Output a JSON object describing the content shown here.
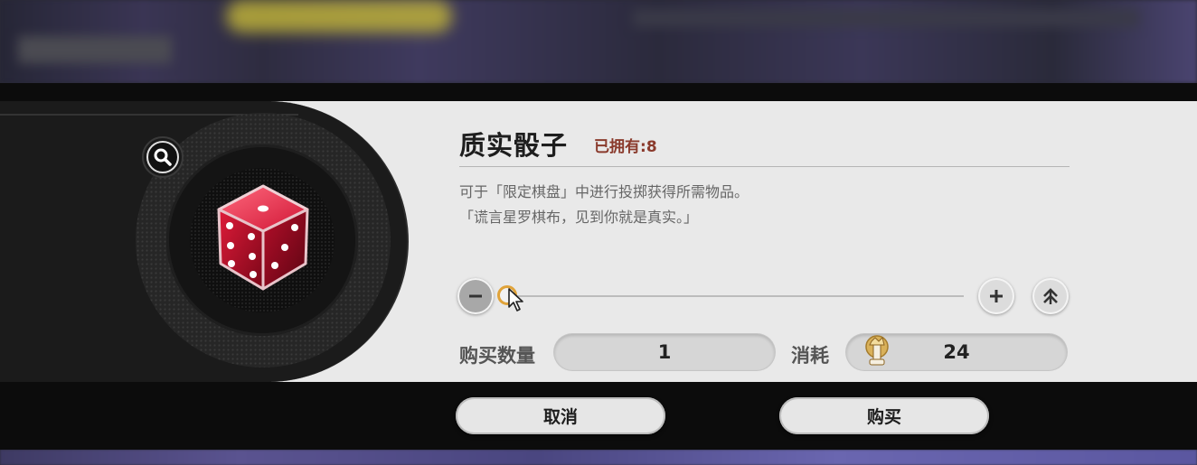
{
  "item": {
    "name": "质实骰子",
    "owned_label": "已拥有:",
    "owned_count": "8",
    "description_line1": "可于「限定棋盘」中进行投掷获得所需物品。",
    "description_line2": "「谎言星罗棋布，见到你就是真实。」"
  },
  "quantity": {
    "label": "购买数量",
    "value": "1",
    "minus_icon": "minus-icon",
    "plus_icon": "plus-icon",
    "max_icon": "double-chevron-up-icon",
    "slider_fraction": 0
  },
  "cost": {
    "label": "消耗",
    "value": "24",
    "currency_icon": "chess-piece-currency-icon"
  },
  "buttons": {
    "cancel": "取消",
    "buy": "购买"
  },
  "colors": {
    "owned_text": "#8a3a2c",
    "slider_handle": "#e0a33a",
    "dice_red": "#c0122c"
  }
}
